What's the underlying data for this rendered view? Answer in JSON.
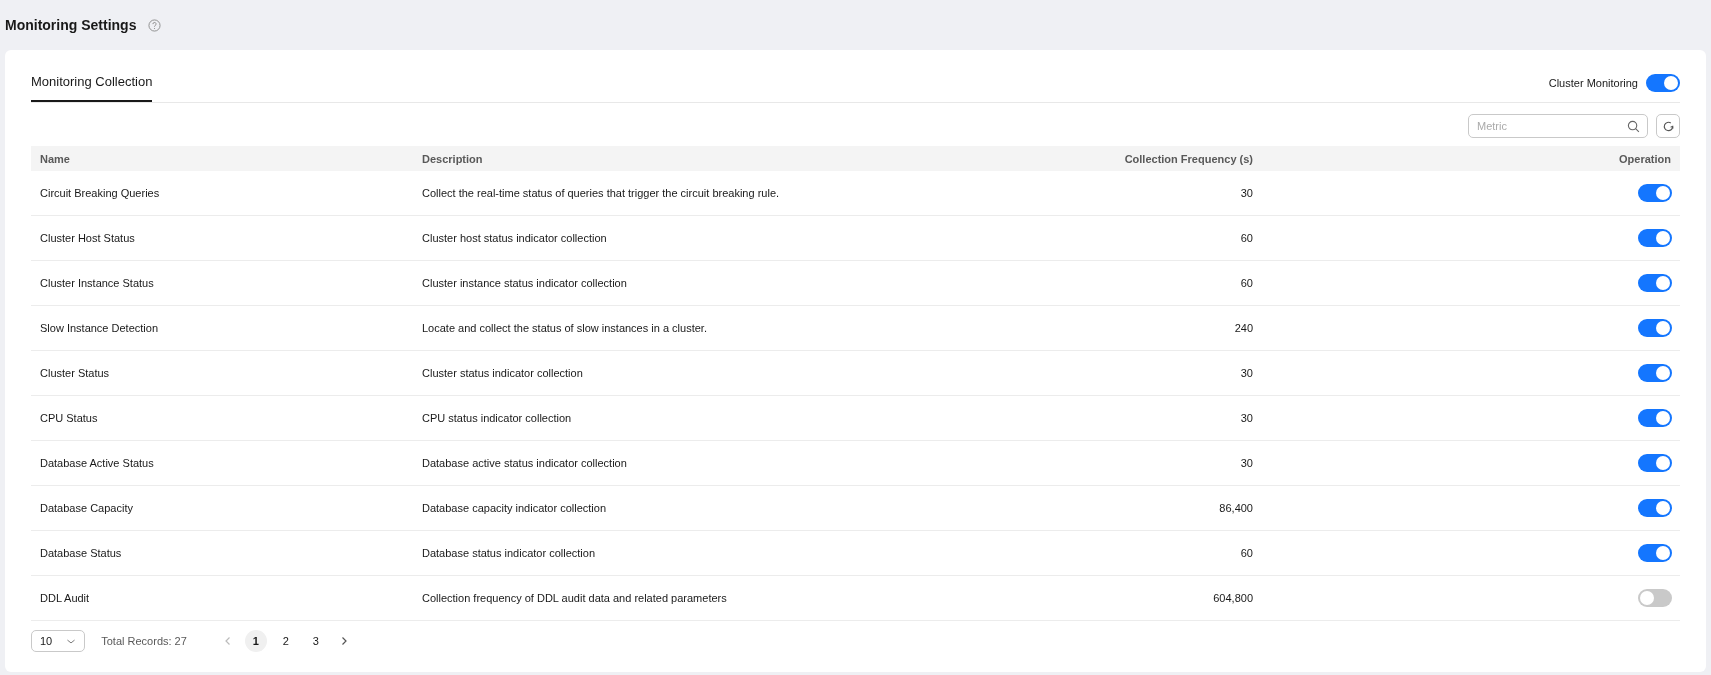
{
  "page": {
    "title": "Monitoring Settings"
  },
  "tabs": [
    {
      "label": "Monitoring Collection",
      "selected": true
    }
  ],
  "cluster_monitoring": {
    "label": "Cluster Monitoring",
    "on": true
  },
  "search": {
    "placeholder": "Metric"
  },
  "table": {
    "columns": [
      "Name",
      "Description",
      "Collection Frequency (s)",
      "Operation"
    ],
    "rows": [
      {
        "name": "Circuit Breaking Queries",
        "description": "Collect the real-time status of queries that trigger the circuit breaking rule.",
        "frequency": "30",
        "on": true
      },
      {
        "name": "Cluster Host Status",
        "description": "Cluster host status indicator collection",
        "frequency": "60",
        "on": true
      },
      {
        "name": "Cluster Instance Status",
        "description": "Cluster instance status indicator collection",
        "frequency": "60",
        "on": true
      },
      {
        "name": "Slow Instance Detection",
        "description": "Locate and collect the status of slow instances in a cluster.",
        "frequency": "240",
        "on": true
      },
      {
        "name": "Cluster Status",
        "description": "Cluster status indicator collection",
        "frequency": "30",
        "on": true
      },
      {
        "name": "CPU Status",
        "description": "CPU status indicator collection",
        "frequency": "30",
        "on": true
      },
      {
        "name": "Database Active Status",
        "description": "Database active status indicator collection",
        "frequency": "30",
        "on": true
      },
      {
        "name": "Database Capacity",
        "description": "Database capacity indicator collection",
        "frequency": "86,400",
        "on": true
      },
      {
        "name": "Database Status",
        "description": "Database status indicator collection",
        "frequency": "60",
        "on": true
      },
      {
        "name": "DDL Audit",
        "description": "Collection frequency of DDL audit data and related parameters",
        "frequency": "604,800",
        "on": false
      }
    ]
  },
  "pagination": {
    "page_size": "10",
    "total": "Total Records: 27",
    "pages": [
      {
        "label": "1",
        "selected": true
      },
      {
        "label": "2",
        "selected": false
      },
      {
        "label": "3",
        "selected": false
      }
    ]
  }
}
